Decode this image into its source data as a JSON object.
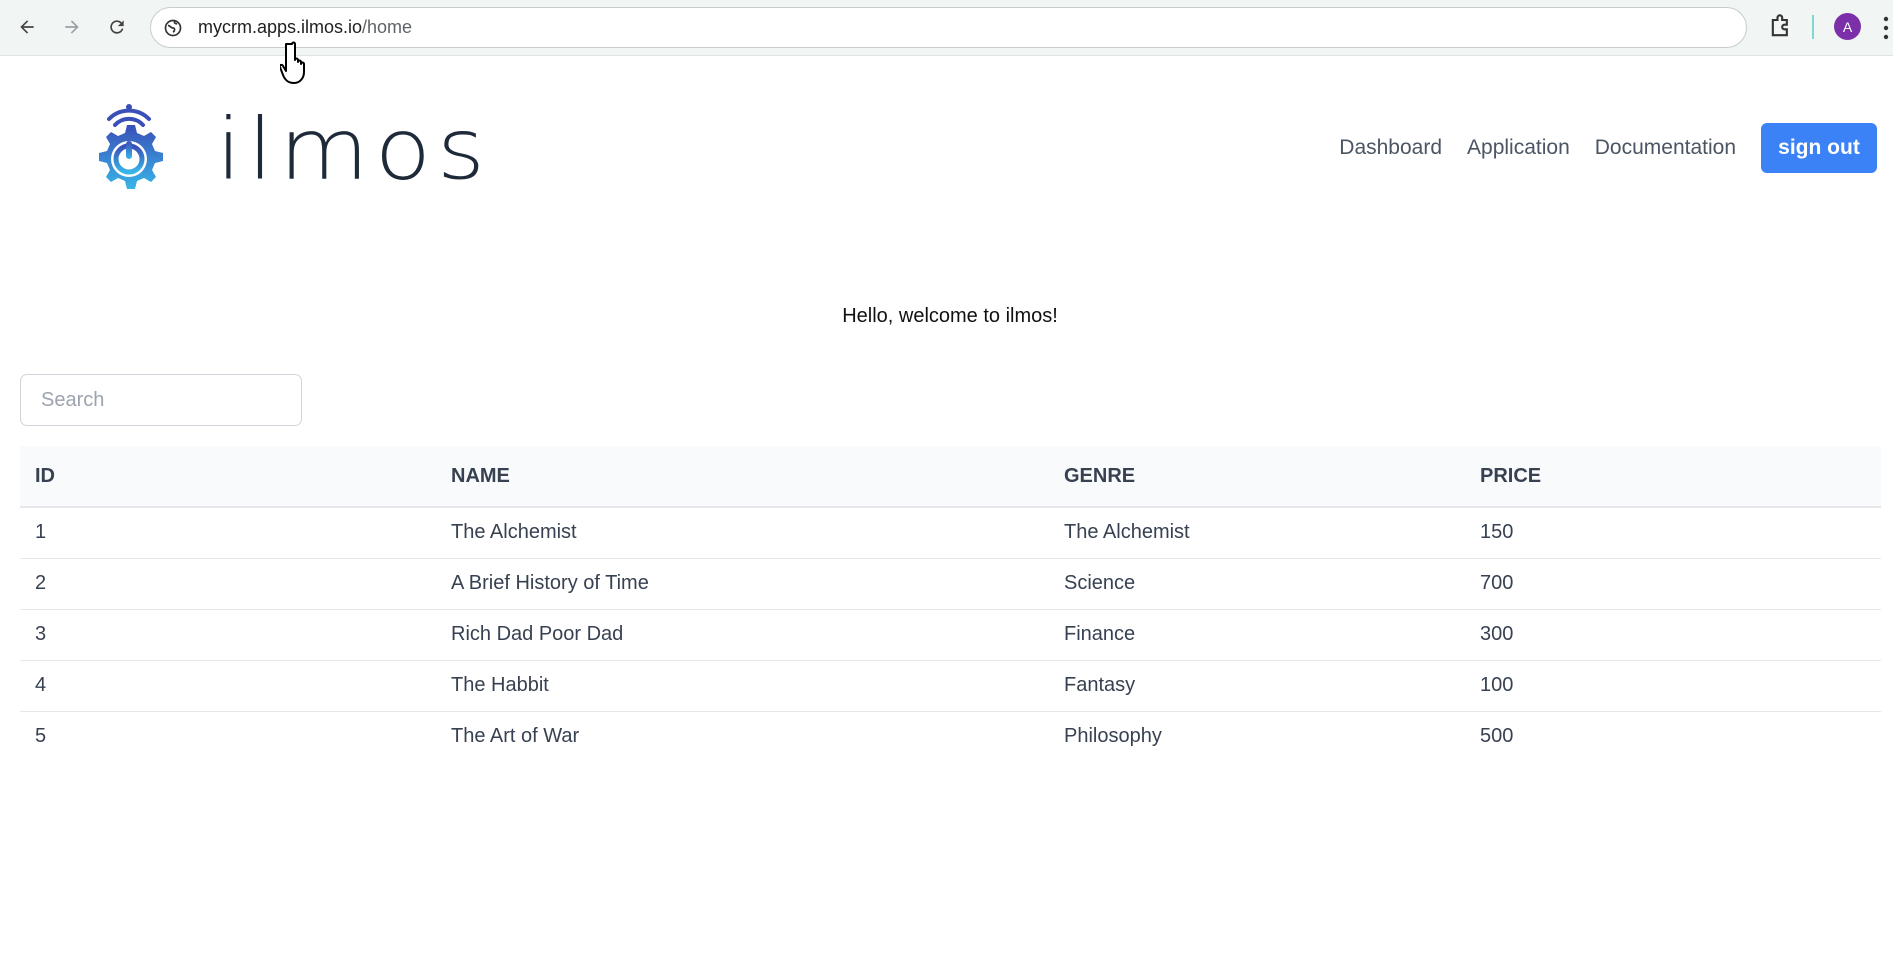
{
  "browser": {
    "url_host": "mycrm.apps.ilmos.io",
    "url_path": "/home",
    "profile_initial": "A"
  },
  "header": {
    "brand": "ilmos",
    "nav": [
      "Dashboard",
      "Application",
      "Documentation"
    ],
    "signout_label": "sign out",
    "accent": "#3b82f6"
  },
  "welcome": "Hello, welcome to ilmos!",
  "search": {
    "placeholder": "Search",
    "value": ""
  },
  "table": {
    "columns": [
      "ID",
      "NAME",
      "GENRE",
      "PRICE"
    ],
    "rows": [
      [
        "1",
        "The Alchemist",
        "The Alchemist",
        "150"
      ],
      [
        "2",
        "A Brief History of Time",
        "Science",
        "700"
      ],
      [
        "3",
        "Rich Dad Poor Dad",
        "Finance",
        "300"
      ],
      [
        "4",
        "The Habbit",
        "Fantasy",
        "100"
      ],
      [
        "5",
        "The Art of War",
        "Philosophy",
        "500"
      ]
    ]
  }
}
